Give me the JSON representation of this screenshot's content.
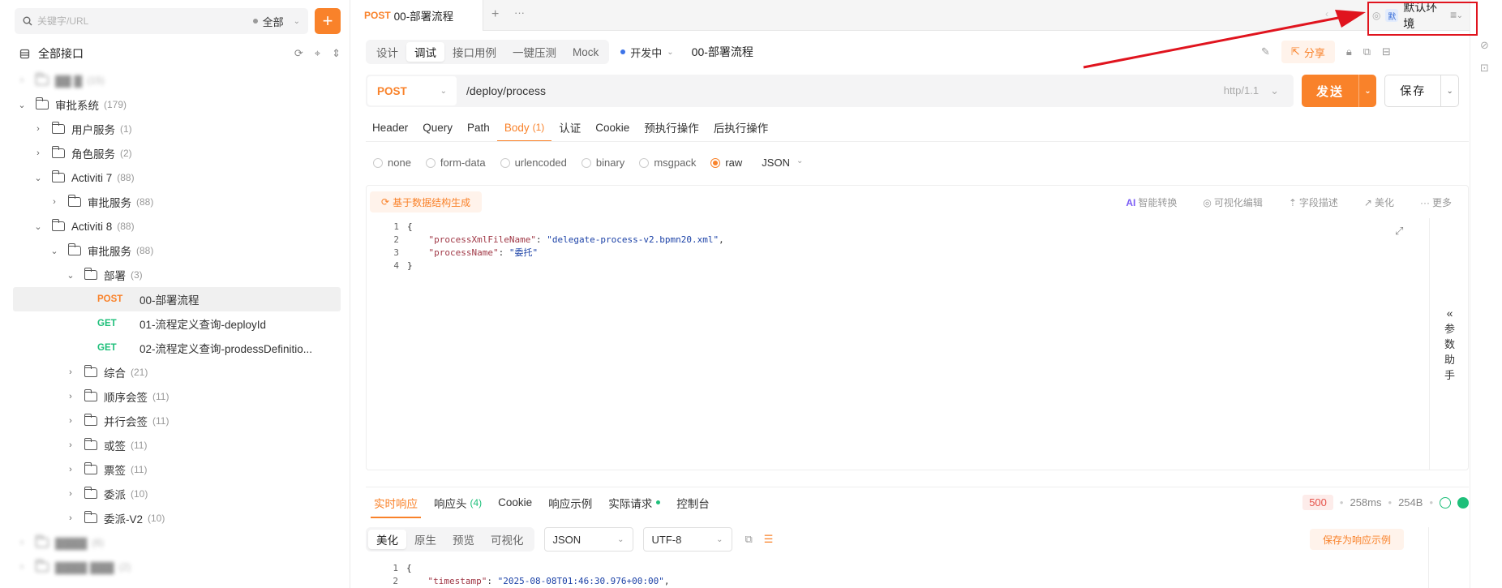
{
  "sidebar": {
    "search_placeholder": "关键字/URL",
    "scope_label": "全部",
    "add_label": "+",
    "all_api_label": "全部接口",
    "tree": [
      {
        "arrow": "›",
        "label": "▓▓ ▓",
        "count": "(15)",
        "blur": true,
        "indent": 0
      },
      {
        "arrow": "⌄",
        "label": "审批系统",
        "count": "(179)",
        "indent": 0
      },
      {
        "arrow": "›",
        "label": "用户服务",
        "count": "(1)",
        "indent": 1
      },
      {
        "arrow": "›",
        "label": "角色服务",
        "count": "(2)",
        "indent": 1
      },
      {
        "arrow": "⌄",
        "label": "Activiti 7",
        "count": "(88)",
        "indent": 1
      },
      {
        "arrow": "›",
        "label": "审批服务",
        "count": "(88)",
        "indent": 2
      },
      {
        "arrow": "⌄",
        "label": "Activiti 8",
        "count": "(88)",
        "indent": 1
      },
      {
        "arrow": "⌄",
        "label": "审批服务",
        "count": "(88)",
        "indent": 2
      },
      {
        "arrow": "⌄",
        "label": "部署",
        "count": "(3)",
        "indent": 3
      },
      {
        "method": "POST",
        "label": "00-部署流程",
        "indent": 4,
        "selected": true
      },
      {
        "method": "GET",
        "label": "01-流程定义查询-deployId",
        "indent": 4
      },
      {
        "method": "GET",
        "label": "02-流程定义查询-prodessDefinitio...",
        "indent": 4
      },
      {
        "arrow": "›",
        "label": "综合",
        "count": "(21)",
        "indent": 3
      },
      {
        "arrow": "›",
        "label": "顺序会签",
        "count": "(11)",
        "indent": 3
      },
      {
        "arrow": "›",
        "label": "并行会签",
        "count": "(11)",
        "indent": 3
      },
      {
        "arrow": "›",
        "label": "或签",
        "count": "(11)",
        "indent": 3
      },
      {
        "arrow": "›",
        "label": "票签",
        "count": "(11)",
        "indent": 3
      },
      {
        "arrow": "›",
        "label": "委派",
        "count": "(10)",
        "indent": 3
      },
      {
        "arrow": "›",
        "label": "委派-V2",
        "count": "(10)",
        "indent": 3
      },
      {
        "arrow": "›",
        "label": "▓▓▓▓",
        "count": "(6)",
        "blur": true,
        "indent": 0
      },
      {
        "arrow": "›",
        "label": "▓▓▓▓ ▓▓▓",
        "count": "(2)",
        "blur": true,
        "indent": 0
      }
    ]
  },
  "tab": {
    "method": "POST",
    "title": "00-部署流程"
  },
  "env": {
    "badge": "默",
    "label": "默认环境"
  },
  "subbar": {
    "modes": [
      "设计",
      "调试",
      "接口用例",
      "一键压测",
      "Mock"
    ],
    "active_mode": 1,
    "status": "开发中",
    "api_title": "00-部署流程",
    "share_label": "分享"
  },
  "request": {
    "method": "POST",
    "path": "/deploy/process",
    "http_version": "http/1.1",
    "send_label": "发送",
    "save_label": "保存",
    "tabs": [
      "Header",
      "Query",
      "Path",
      "Body",
      "认证",
      "Cookie",
      "预执行操作",
      "后执行操作"
    ],
    "body_badge": "(1)",
    "active_tab": 3,
    "body_types": [
      "none",
      "form-data",
      "urlencoded",
      "binary",
      "msgpack",
      "raw"
    ],
    "selected_body_type": "raw",
    "raw_format": "JSON",
    "gen_label": "基于数据结构生成",
    "editor_tools": [
      "智能转换",
      "可视化编辑",
      "字段描述",
      "美化",
      "更多"
    ],
    "ai_label": "AI",
    "param_helper": [
      "参",
      "数",
      "助",
      "手"
    ]
  },
  "code_lines": [
    {
      "n": "1",
      "parts": [
        [
          "p",
          "{"
        ]
      ]
    },
    {
      "n": "2",
      "parts": [
        [
          "p",
          "    "
        ],
        [
          "k",
          "\"processXmlFileName\""
        ],
        [
          "p",
          ": "
        ],
        [
          "s",
          "\"delegate-process-v2.bpmn20.xml\""
        ],
        [
          "p",
          ","
        ]
      ]
    },
    {
      "n": "3",
      "parts": [
        [
          "p",
          "    "
        ],
        [
          "k",
          "\"processName\""
        ],
        [
          "p",
          ": "
        ],
        [
          "s",
          "\"委托\""
        ]
      ]
    },
    {
      "n": "4",
      "parts": [
        [
          "p",
          "}"
        ]
      ]
    }
  ],
  "response": {
    "tabs": [
      "实时响应",
      "响应头",
      "Cookie",
      "响应示例",
      "实际请求",
      "控制台"
    ],
    "header_badge": "(4)",
    "status_code": "500",
    "time": "258ms",
    "size": "254B",
    "view_modes": [
      "美化",
      "原生",
      "预览",
      "可视化"
    ],
    "format": "JSON",
    "encoding": "UTF-8",
    "save_example_label": "保存为响应示例",
    "code_lines": [
      {
        "n": "1",
        "parts": [
          [
            "p",
            "{"
          ]
        ]
      },
      {
        "n": "2",
        "parts": [
          [
            "p",
            "    "
          ],
          [
            "k",
            "\"timestamp\""
          ],
          [
            "p",
            ": "
          ],
          [
            "s",
            "\"2025-08-08T01:46:30.976+00:00\""
          ],
          [
            "p",
            ","
          ]
        ]
      }
    ]
  },
  "colors": {
    "accent": "#f9822a",
    "get": "#1ebf7a",
    "annotation": "#e0141e"
  }
}
